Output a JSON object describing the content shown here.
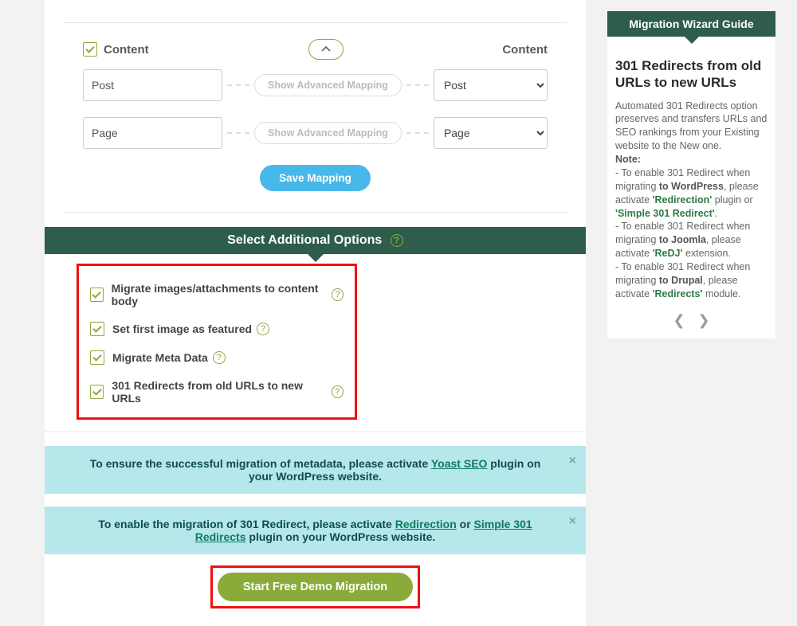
{
  "mapping": {
    "header_left": "Content",
    "header_right": "Content",
    "rows": [
      {
        "source": "Post",
        "advanced": "Show Advanced Mapping",
        "target": "Post"
      },
      {
        "source": "Page",
        "advanced": "Show Advanced Mapping",
        "target": "Page"
      }
    ],
    "save_label": "Save Mapping"
  },
  "section": {
    "title": "Select Additional Options",
    "help": "?"
  },
  "options": [
    {
      "label": "Migrate images/attachments to content body",
      "help": "?"
    },
    {
      "label": "Set first image as featured",
      "help": "?"
    },
    {
      "label": "Migrate Meta Data",
      "help": "?"
    },
    {
      "label": "301 Redirects from old URLs to new URLs",
      "help": "?"
    }
  ],
  "alerts": {
    "a1_pre": "To ensure the successful migration of metadata, please activate ",
    "a1_link": "Yoast SEO",
    "a1_post": " plugin on your WordPress website.",
    "a2_pre": "To enable the migration of 301 Redirect, please activate ",
    "a2_link1": "Redirection",
    "a2_mid": " or ",
    "a2_link2": "Simple 301 Redirects",
    "a2_post": " plugin on your WordPress website."
  },
  "start_label": "Start Free Demo Migration",
  "sidebar": {
    "header": "Migration Wizard Guide",
    "title": "301 Redirects from old URLs to new URLs",
    "intro": "Automated 301 Redirects option preserves and transfers URLs and SEO rankings from your Existing website to the New one.",
    "note_label": "Note:",
    "wp_pre": "- To enable 301 Redirect when migrating ",
    "wp_bold": "to WordPress",
    "wp_mid": ", please activate ",
    "wp_link1": "'Redirection'",
    "wp_mid2": " plugin or ",
    "wp_link2": "'Simple 301 Redirect'",
    "wp_post": ".",
    "joomla_pre": "- To enable 301 Redirect when migrating ",
    "joomla_bold": "to Joomla",
    "joomla_mid": ", please activate ",
    "joomla_link": "'ReDJ'",
    "joomla_post": " extension.",
    "drupal_pre": "- To enable 301 Redirect when migrating ",
    "drupal_bold": "to Drupal",
    "drupal_mid": ", please activate ",
    "drupal_link": "'Redirects'",
    "drupal_post": " module."
  }
}
